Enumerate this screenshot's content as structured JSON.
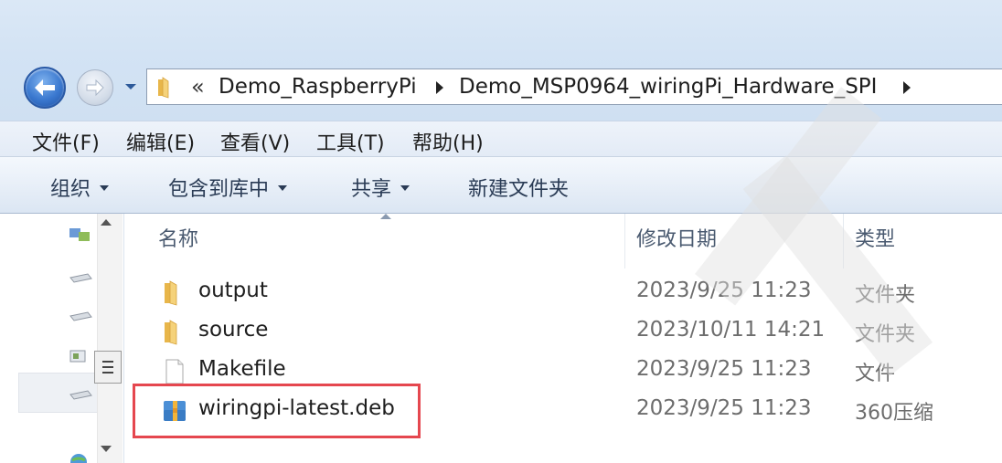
{
  "address_bar": {
    "overflow_glyph": "«",
    "crumbs": [
      "Demo_RaspberryPi",
      "Demo_MSP0964_wiringPi_Hardware_SPI"
    ]
  },
  "menu": {
    "items": [
      "文件(F)",
      "编辑(E)",
      "查看(V)",
      "工具(T)",
      "帮助(H)"
    ]
  },
  "command_bar": {
    "organize": "组织",
    "include_in_library": "包含到库中",
    "share": "共享",
    "new_folder": "新建文件夹"
  },
  "columns": {
    "name": "名称",
    "date_modified": "修改日期",
    "type": "类型"
  },
  "files": [
    {
      "name": "output",
      "date": "2023/9/25 11:23",
      "type": "文件夹",
      "icon": "folder-icon"
    },
    {
      "name": "source",
      "date": "2023/10/11 14:21",
      "type": "文件夹",
      "icon": "folder-icon"
    },
    {
      "name": "Makefile",
      "date": "2023/9/25 11:23",
      "type": "文件",
      "icon": "file-icon"
    },
    {
      "name": "wiringpi-latest.deb",
      "date": "2023/9/25 11:23",
      "type": "360压缩",
      "icon": "archive-icon"
    }
  ],
  "colors": {
    "highlight": "#e5474f",
    "chrome": "#d3e3f4"
  }
}
